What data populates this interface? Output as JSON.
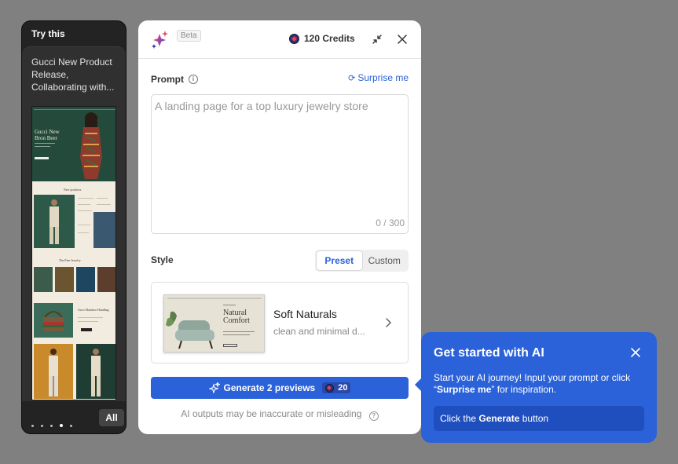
{
  "try_panel": {
    "header": "Try this",
    "card_title": "Gucci New Product Release, Collaborating with...",
    "hero_title_line1": "Gucci New",
    "hero_title_line2": "Bron Beer",
    "section1": "New products",
    "section2": "The Fine Jewelry",
    "section3": "Gucci Bamboo Handbag",
    "dots_total": 5,
    "dots_active_index": 3,
    "all_label": "All"
  },
  "dialog": {
    "beta_label": "Beta",
    "credits_label": "120 Credits",
    "prompt_label": "Prompt",
    "surprise_label": "Surprise me",
    "prompt_value": "",
    "prompt_placeholder": "A landing page for a top luxury jewelry store",
    "counter": "0 / 300",
    "style_label": "Style",
    "segments": {
      "preset": "Preset",
      "custom": "Custom",
      "selected": "preset"
    },
    "preset": {
      "thumb_title_line1": "Natural",
      "thumb_title_line2": "Comfort",
      "name": "Soft Naturals",
      "description": "clean and minimal d..."
    },
    "generate_label": "Generate 2 previews",
    "generate_cost": "20",
    "disclaimer": "AI outputs may be inaccurate or misleading"
  },
  "tooltip": {
    "title": "Get started with AI",
    "body_part1": "Start your AI journey! Input your prompt or click “",
    "body_bold": "Surprise me",
    "body_part2": "” for inspiration.",
    "cta_part1": "Click the ",
    "cta_bold": "Generate",
    "cta_part2": " button"
  },
  "colors": {
    "accent": "#2b62d9",
    "backdrop": "#808080",
    "panel_dark": "#232323"
  },
  "icons": {
    "logo": "sparkle-logo-icon",
    "minimize": "collapse-arrows-icon",
    "close": "close-icon",
    "info": "info-icon",
    "refresh": "refresh-icon",
    "chevron": "chevron-right-icon",
    "generate": "sparkle-icon",
    "help": "question-icon"
  }
}
